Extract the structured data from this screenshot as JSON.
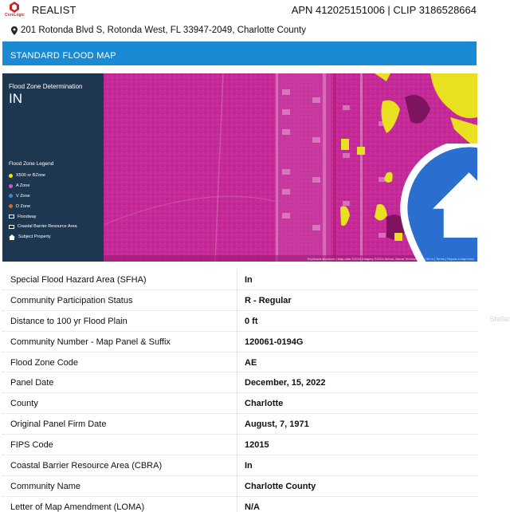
{
  "header": {
    "logo_text": "CoreLogic",
    "brand": "REALIST",
    "apn_clip": "APN 412025151006 | CLIP 3186528664"
  },
  "address": "201 Rotonda Blvd S, Rotonda West, FL 33947-2049, Charlotte County",
  "section_title": "STANDARD FLOOD MAP",
  "map": {
    "determination_label": "Flood Zone Determination",
    "determination_value": "IN",
    "legend_title": "Flood Zone Legend",
    "legend": [
      {
        "label": "X500 or BZone",
        "icon": "dot",
        "color": "#f1e600"
      },
      {
        "label": "A Zone",
        "icon": "dot",
        "color": "#e54bd8"
      },
      {
        "label": "V Zone",
        "icon": "dot",
        "color": "#2a8ee0"
      },
      {
        "label": "D Zone",
        "icon": "dot",
        "color": "#d06a3a"
      },
      {
        "label": "Floodway",
        "icon": "square",
        "color": "#ffffff"
      },
      {
        "label": "Coastal Barrier Resource Area",
        "icon": "square",
        "color": "#ffffff"
      },
      {
        "label": "Subject Property",
        "icon": "house",
        "color": "#ffffff"
      }
    ],
    "attribution": "Keyboard shortcuts | Map data ©2024 Imagery ©2024 Airbus, Maxar Technologies | 50 m | Terms | Report a map error"
  },
  "details": [
    {
      "label": "Special Flood Hazard Area (SFHA)",
      "value": "In"
    },
    {
      "label": "Community Participation Status",
      "value": "R - Regular"
    },
    {
      "label": "Distance to 100 yr Flood Plain",
      "value": "0 ft"
    },
    {
      "label": "Community Number - Map Panel & Suffix",
      "value": "120061-0194G"
    },
    {
      "label": "Flood Zone Code",
      "value": "AE"
    },
    {
      "label": "Panel Date",
      "value": "December, 15, 2022"
    },
    {
      "label": "County",
      "value": "Charlotte"
    },
    {
      "label": "Original Panel Firm Date",
      "value": "August, 7, 1971"
    },
    {
      "label": "FIPS Code",
      "value": "12015"
    },
    {
      "label": "Coastal Barrier Resource Area (CBRA)",
      "value": "In"
    },
    {
      "label": "Community Name",
      "value": "Charlotte County"
    },
    {
      "label": "Letter of Map Amendment (LOMA)",
      "value": "N/A"
    }
  ],
  "watermark": "Stellar",
  "colors": {
    "banner": "#1a8ad4",
    "panel": "#1d3750",
    "flood_magenta": "#c9279a",
    "zone_yellow": "#e8e020"
  }
}
